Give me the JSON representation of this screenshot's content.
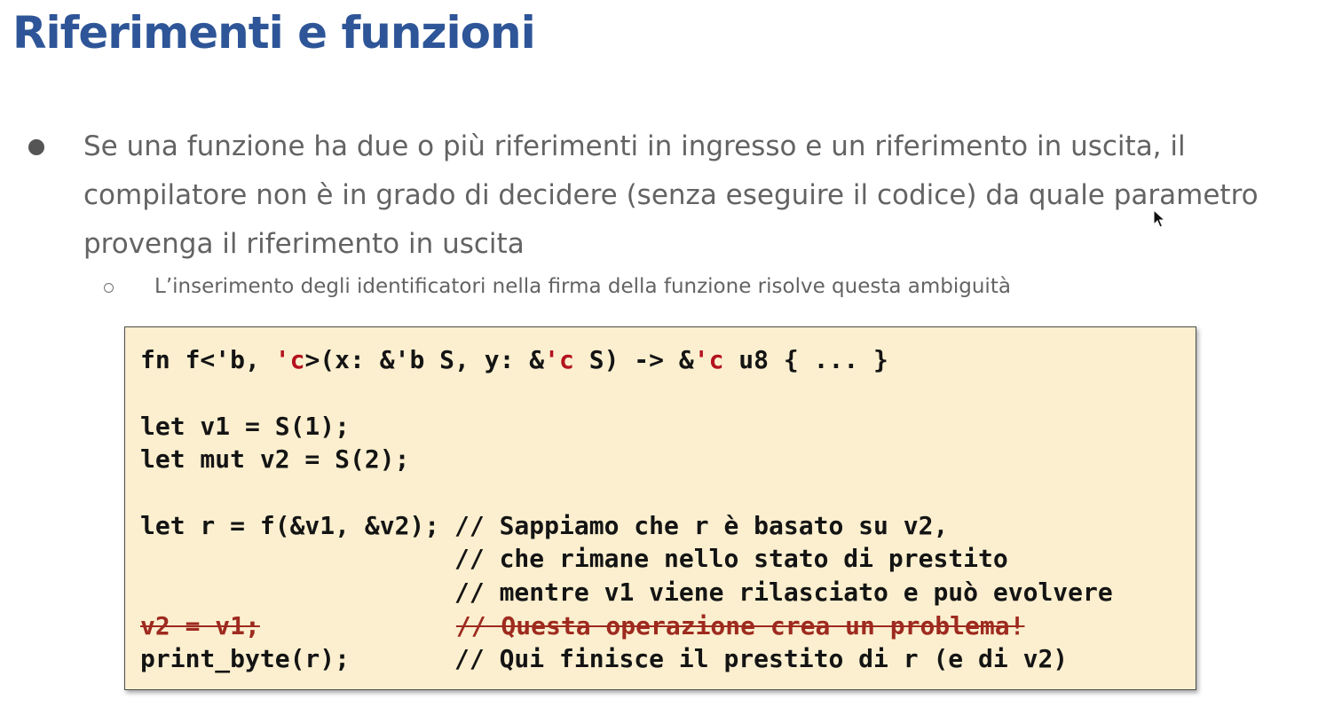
{
  "slide": {
    "title": "Riferimenti e funzioni",
    "bullet": {
      "lines": [
        "Se una funzione ha due o più riferimenti in ingresso e un riferimento in uscita, il",
        "compilatore non è in grado di decidere (senza eseguire il codice) da quale parametro",
        "provenga il riferimento in uscita"
      ]
    },
    "subbullet": "L’inserimento degli identificatori nella firma della funzione risolve questa ambiguità"
  },
  "code": {
    "sig": {
      "a": "fn f<'b, ",
      "b": "'c",
      "c": ">(x: &'b S, y: &",
      "d": "'c",
      "e": " S) -> &",
      "f": "'c",
      "g": " u8 { ... }"
    },
    "line_v1": "let v1 = S(1);",
    "line_v2": "let mut v2 = S(2);",
    "line_r": "let r = f(&v1, &v2); // Sappiamo che r è basato su v2,",
    "line_c1": "                     // che rimane nello stato di prestito",
    "line_c2": "                     // mentre v1 viene rilasciato e può evolvere",
    "strike": {
      "stmt": "v2 = v1;",
      "comment": "// Questa operazione crea un problema!"
    },
    "line_print": "print_byte(r);       // Qui finisce il prestito di r (e di v2)"
  },
  "colors": {
    "title": "#2e5597",
    "text": "#636363",
    "code_bg": "#fbefcf",
    "lifetime_highlight": "#b4121e",
    "strikethrough": "#9e2a1f"
  },
  "icons": {
    "bullet": "filled-circle",
    "subbullet": "hollow-circle",
    "cursor": "mouse-pointer"
  }
}
